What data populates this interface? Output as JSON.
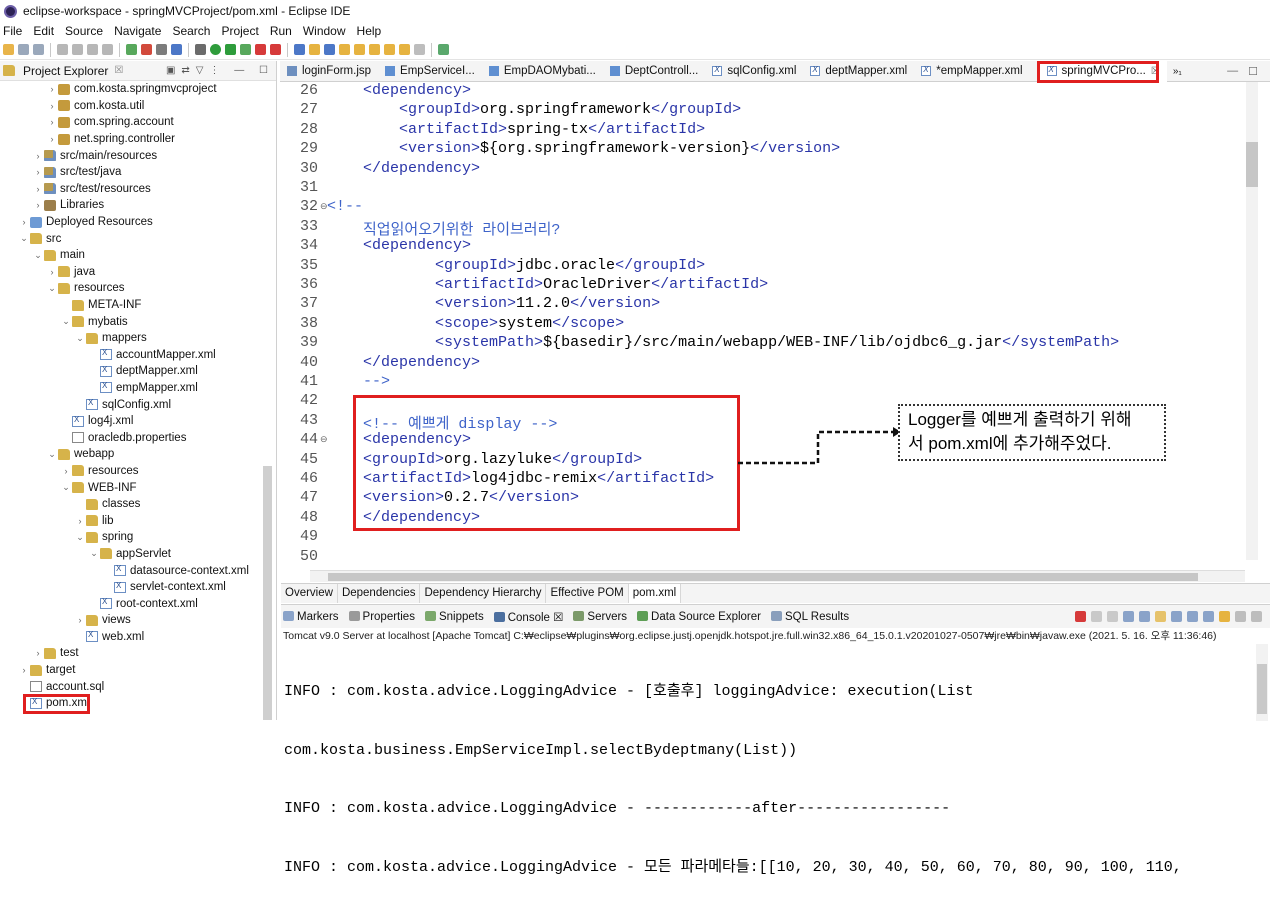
{
  "window": {
    "title": "eclipse-workspace - springMVCProject/pom.xml - Eclipse IDE"
  },
  "menu": [
    "File",
    "Edit",
    "Source",
    "Navigate",
    "Search",
    "Project",
    "Run",
    "Window",
    "Help"
  ],
  "explorer": {
    "title": "Project Explorer",
    "close": "☒",
    "items": [
      {
        "label": "com.kosta.springmvcproject",
        "icon": "package-icon",
        "expand": "›"
      },
      {
        "label": "com.kosta.util",
        "icon": "package-icon",
        "expand": "›"
      },
      {
        "label": "com.spring.account",
        "icon": "package-icon",
        "expand": "›"
      },
      {
        "label": "net.spring.controller",
        "icon": "package-icon",
        "expand": "›"
      },
      {
        "label": "src/main/resources",
        "icon": "source-folder-icon",
        "expand": "›"
      },
      {
        "label": "src/test/java",
        "icon": "source-folder-icon",
        "expand": "›"
      },
      {
        "label": "src/test/resources",
        "icon": "source-folder-icon",
        "expand": "›"
      },
      {
        "label": "Libraries",
        "icon": "library-icon",
        "expand": "›"
      },
      {
        "label": "Deployed Resources",
        "icon": "deployed-icon",
        "expand": "›"
      },
      {
        "label": "src",
        "icon": "folder-icon",
        "expand": "⌄"
      },
      {
        "label": "main",
        "icon": "folder-icon",
        "expand": "⌄"
      },
      {
        "label": "java",
        "icon": "folder-icon",
        "expand": "›"
      },
      {
        "label": "resources",
        "icon": "folder-icon",
        "expand": "⌄"
      },
      {
        "label": "META-INF",
        "icon": "folder-icon",
        "expand": ""
      },
      {
        "label": "mybatis",
        "icon": "folder-icon",
        "expand": "⌄"
      },
      {
        "label": "mappers",
        "icon": "folder-icon",
        "expand": "⌄"
      },
      {
        "label": "accountMapper.xml",
        "icon": "xml-file-icon",
        "expand": ""
      },
      {
        "label": "deptMapper.xml",
        "icon": "xml-file-icon",
        "expand": ""
      },
      {
        "label": "empMapper.xml",
        "icon": "xml-file-icon",
        "expand": ""
      },
      {
        "label": "sqlConfig.xml",
        "icon": "xml-file-icon",
        "expand": ""
      },
      {
        "label": "log4j.xml",
        "icon": "xml-file-icon",
        "expand": ""
      },
      {
        "label": "oracledb.properties",
        "icon": "file-icon",
        "expand": ""
      },
      {
        "label": "webapp",
        "icon": "folder-icon",
        "expand": "⌄"
      },
      {
        "label": "resources",
        "icon": "folder-icon",
        "expand": "›"
      },
      {
        "label": "WEB-INF",
        "icon": "folder-icon",
        "expand": "⌄"
      },
      {
        "label": "classes",
        "icon": "folder-icon",
        "expand": ""
      },
      {
        "label": "lib",
        "icon": "folder-icon",
        "expand": "›"
      },
      {
        "label": "spring",
        "icon": "folder-icon",
        "expand": "⌄"
      },
      {
        "label": "appServlet",
        "icon": "folder-icon",
        "expand": "⌄"
      },
      {
        "label": "datasource-context.xml",
        "icon": "xml-file-icon",
        "expand": ""
      },
      {
        "label": "servlet-context.xml",
        "icon": "xml-file-icon",
        "expand": ""
      },
      {
        "label": "root-context.xml",
        "icon": "xml-file-icon",
        "expand": ""
      },
      {
        "label": "views",
        "icon": "folder-icon",
        "expand": "›"
      },
      {
        "label": "web.xml",
        "icon": "xml-file-icon",
        "expand": ""
      },
      {
        "label": "test",
        "icon": "folder-icon",
        "expand": "›"
      },
      {
        "label": "target",
        "icon": "folder-icon",
        "expand": "›"
      },
      {
        "label": "account.sql",
        "icon": "file-icon",
        "expand": ""
      },
      {
        "label": "pom.xml",
        "icon": "xml-file-icon",
        "expand": "",
        "highlighted": true
      }
    ]
  },
  "editor_tabs": [
    {
      "label": "loginForm.jsp",
      "active": false
    },
    {
      "label": "EmpServiceI...",
      "active": false
    },
    {
      "label": "EmpDAOMybati...",
      "active": false
    },
    {
      "label": "DeptControll...",
      "active": false
    },
    {
      "label": "sqlConfig.xml",
      "active": false
    },
    {
      "label": "deptMapper.xml",
      "active": false
    },
    {
      "label": "*empMapper.xml",
      "active": false
    },
    {
      "label": "springMVCPro...",
      "active": true,
      "close": "☒"
    }
  ],
  "tab_overflow": "»₁",
  "code": {
    "line_numbers": [
      "26",
      "27",
      "28",
      "29",
      "30",
      "31",
      "32",
      "33",
      "34",
      "35",
      "36",
      "37",
      "38",
      "39",
      "40",
      "41",
      "42",
      "43",
      "44",
      "45",
      "46",
      "47",
      "48",
      "49",
      "50"
    ],
    "fold_markers": {
      "32": "⊖",
      "44": "⊖"
    },
    "lines": [
      "    <dependency>",
      "        <groupId>org.springframework</groupId>",
      "        <artifactId>spring-tx</artifactId>",
      "        <version>${org.springframework-version}</version>",
      "    </dependency>",
      "",
      "<!--",
      "    직업읽어오기위한 라이브러리?",
      "    <dependency>",
      "            <groupId>jdbc.oracle</groupId>",
      "            <artifactId>OracleDriver</artifactId>",
      "            <version>11.2.0</version>",
      "            <scope>system</scope>",
      "            <systemPath>${basedir}/src/main/webapp/WEB-INF/lib/ojdbc6_g.jar</systemPath>",
      "    </dependency>",
      "    -->",
      "",
      "    <!-- 예쁘게 display -->",
      "    <dependency>",
      "    <groupId>org.lazyluke</groupId>",
      "    <artifactId>log4jdbc-remix</artifactId>",
      "    <version>0.2.7</version>",
      "    </dependency>",
      "",
      ""
    ]
  },
  "annotation": {
    "line1": "Logger를 예쁘게 출력하기 위해",
    "line2": "서 pom.xml에 추가해주었다."
  },
  "bottom_tabs": [
    {
      "label": "Overview",
      "active": false
    },
    {
      "label": "Dependencies",
      "active": false
    },
    {
      "label": "Dependency Hierarchy",
      "active": false
    },
    {
      "label": "Effective POM",
      "active": false
    },
    {
      "label": "pom.xml",
      "active": true
    }
  ],
  "console": {
    "tabs": [
      "Markers",
      "Properties",
      "Snippets",
      "Console ☒",
      "Servers",
      "Data Source Explorer",
      "SQL Results"
    ],
    "status": "Tomcat v9.0 Server at localhost [Apache Tomcat] C:₩eclipse₩plugins₩org.eclipse.justj.openjdk.hotspot.jre.full.win32.x86_64_15.0.1.v20201027-0507₩jre₩bin₩javaw.exe  (2021. 5. 16. 오후 11:36:46)",
    "output": [
      "INFO : com.kosta.advice.LoggingAdvice - [호출후] loggingAdvice: execution(List",
      "com.kosta.business.EmpServiceImpl.selectBydeptmany(List))",
      "INFO : com.kosta.advice.LoggingAdvice - ------------after-----------------",
      "INFO : com.kosta.advice.LoggingAdvice - 모든 파라메타들:[[10, 20, 30, 40, 50, 60, 70, 80, 90, 100, 110,"
    ]
  },
  "colors": {
    "highlight": "#e01f1f",
    "xml_tag": "#2a35a8",
    "comment": "#3e63c9"
  }
}
